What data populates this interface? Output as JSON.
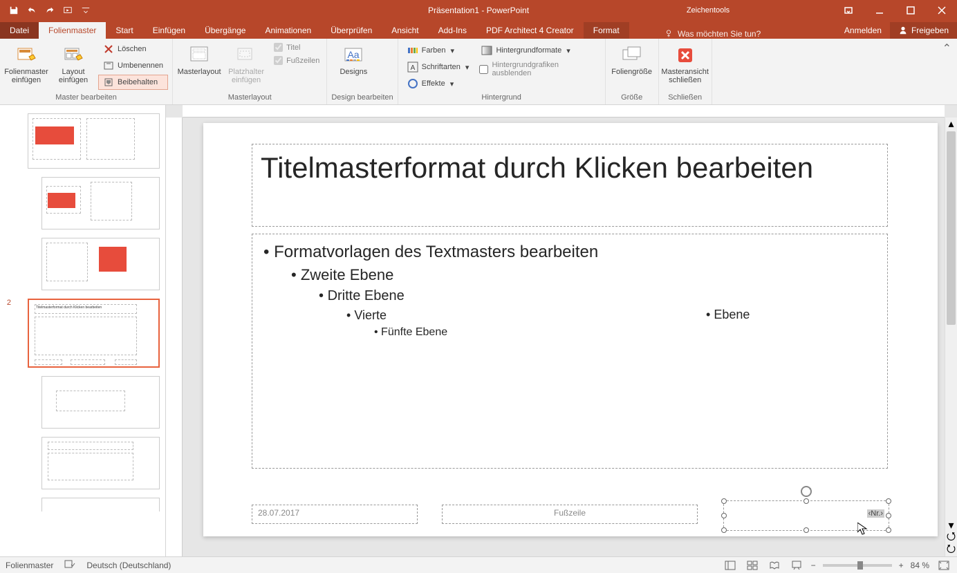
{
  "titlebar": {
    "title": "Präsentation1 - PowerPoint",
    "toolContext": "Zeichentools"
  },
  "tabs": {
    "file": "Datei",
    "slidemaster": "Folienmaster",
    "home": "Start",
    "insert": "Einfügen",
    "transitions": "Übergänge",
    "animations": "Animationen",
    "review": "Überprüfen",
    "view": "Ansicht",
    "addins": "Add-Ins",
    "pdf": "PDF Architect 4 Creator",
    "format": "Format",
    "tellme": "Was möchten Sie tun?",
    "signin": "Anmelden",
    "share": "Freigeben"
  },
  "ribbon": {
    "g1": {
      "insertMaster": "Folienmaster einfügen",
      "insertLayout": "Layout einfügen",
      "delete": "Löschen",
      "rename": "Umbenennen",
      "preserve": "Beibehalten",
      "label": "Master bearbeiten"
    },
    "g2": {
      "masterLayout": "Masterlayout",
      "placeholder": "Platzhalter einfügen",
      "title": "Titel",
      "footers": "Fußzeilen",
      "label": "Masterlayout"
    },
    "g3": {
      "designs": "Designs",
      "colors": "Farben",
      "fonts": "Schriftarten",
      "effects": "Effekte",
      "bgStyles": "Hintergrundformate",
      "hideBg": "Hintergrundgrafiken ausblenden",
      "label1": "Design bearbeiten",
      "label2": "Hintergrund"
    },
    "g4": {
      "size": "Foliengröße",
      "label": "Größe"
    },
    "g5": {
      "close": "Masteransicht schließen",
      "label": "Schließen"
    }
  },
  "slide": {
    "title": "Titelmasterformat durch Klicken bearbeiten",
    "l1": "Formatvorlagen des Textmasters bearbeiten",
    "l2": "Zweite Ebene",
    "l3": "Dritte Ebene",
    "l4a": "Vierte",
    "l4b": "Ebene",
    "l5": "Fünfte Ebene",
    "date": "28.07.2017",
    "footer": "Fußzeile",
    "num": "‹Nr.›"
  },
  "status": {
    "mode": "Folienmaster",
    "lang": "Deutsch (Deutschland)",
    "zoom": "84 %"
  },
  "thumbnum": "2"
}
